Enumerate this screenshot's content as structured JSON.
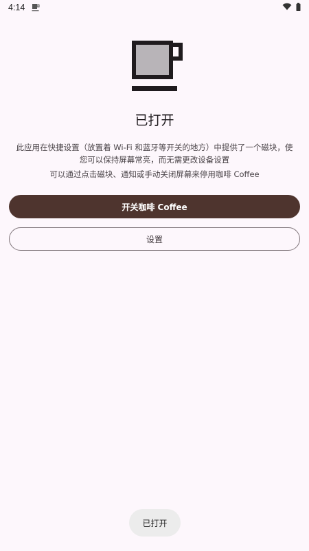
{
  "status_bar": {
    "time": "4:14",
    "app_icon": "coffee-cup-icon",
    "wifi_icon": "wifi-icon",
    "battery_icon": "battery-icon"
  },
  "hero": {
    "icon": "coffee-cup-icon",
    "title": "已打开"
  },
  "description": {
    "line1": "此应用在快捷设置（放置着 Wi-Fi 和蓝牙等开关的地方）中提供了一个磁块，使您可以保持屏幕常亮，而无需更改设备设置",
    "line2": "可以通过点击磁块、通知或手动关闭屏幕来停用咖啡 Coffee"
  },
  "buttons": {
    "toggle_label": "开关咖啡 Coffee",
    "settings_label": "设置"
  },
  "toast": {
    "text": "已打开"
  },
  "colors": {
    "background": "#fdf7fc",
    "primary_button": "#4e342e",
    "cup_fill": "#b8b4b8",
    "cup_outline": "#1f1b1e"
  }
}
